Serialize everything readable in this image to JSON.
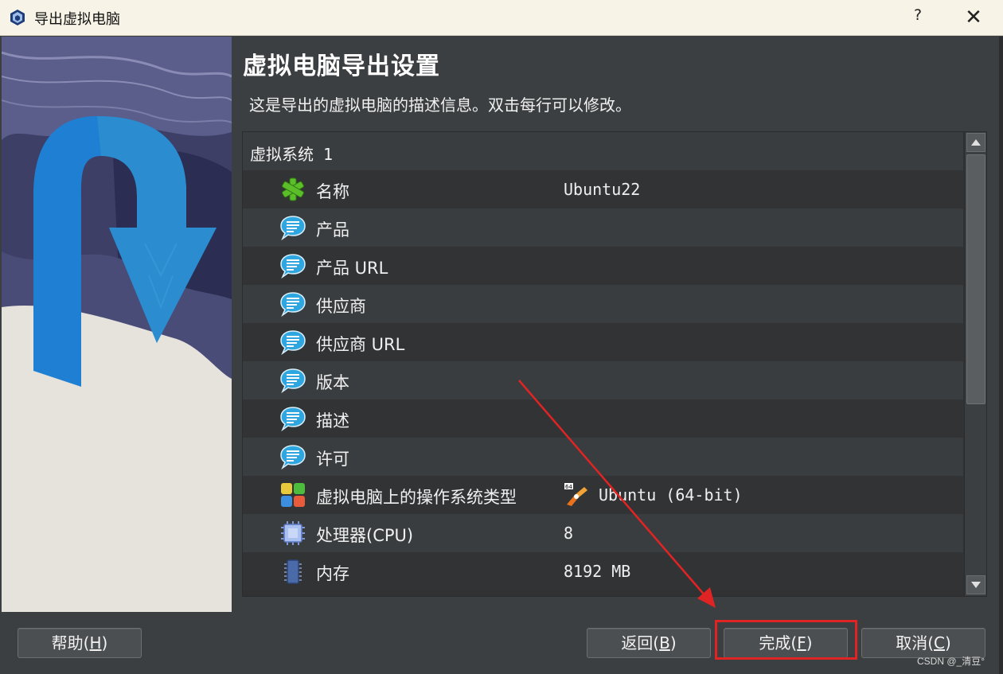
{
  "window": {
    "title": "导出虚拟电脑",
    "help_glyph": "?",
    "close_glyph": "✕"
  },
  "page": {
    "heading": "虚拟电脑导出设置",
    "description": "这是导出的虚拟电脑的描述信息。双击每行可以修改。"
  },
  "table": {
    "group_label": "虚拟系统 1",
    "rows": [
      {
        "icon": "name-star-icon",
        "label": "名称",
        "value": "Ubuntu22"
      },
      {
        "icon": "speech-bubble-icon",
        "label": "产品",
        "value": ""
      },
      {
        "icon": "speech-bubble-icon",
        "label": "产品 URL",
        "value": ""
      },
      {
        "icon": "speech-bubble-icon",
        "label": "供应商",
        "value": ""
      },
      {
        "icon": "speech-bubble-icon",
        "label": "供应商 URL",
        "value": ""
      },
      {
        "icon": "speech-bubble-icon",
        "label": "版本",
        "value": ""
      },
      {
        "icon": "speech-bubble-icon",
        "label": "描述",
        "value": ""
      },
      {
        "icon": "speech-bubble-icon",
        "label": "许可",
        "value": ""
      },
      {
        "icon": "os-type-icon",
        "label": "虚拟电脑上的操作系统类型",
        "value": "Ubuntu (64-bit)"
      },
      {
        "icon": "cpu-icon",
        "label": "处理器(CPU)",
        "value": "8"
      },
      {
        "icon": "memory-icon",
        "label": "内存",
        "value": "8192 MB"
      }
    ]
  },
  "buttons": {
    "help": {
      "text": "帮助(",
      "mnemonic": "H",
      "close": ")"
    },
    "back": {
      "text": "返回(",
      "mnemonic": "B",
      "close": ")"
    },
    "finish": {
      "text": "完成(",
      "mnemonic": "F",
      "close": ")"
    },
    "cancel": {
      "text": "取消(",
      "mnemonic": "C",
      "close": ")"
    }
  },
  "watermark": "CSDN @_清豆°",
  "colors": {
    "titlebar_bg": "#f7f3e6",
    "dialog_bg": "#3c3f41",
    "row_light": "#3a3d3f",
    "row_dark": "#313335",
    "annotation_red": "#e02424",
    "speech_bubble": "#2fa6e0",
    "name_star": "#5cbf2a"
  }
}
